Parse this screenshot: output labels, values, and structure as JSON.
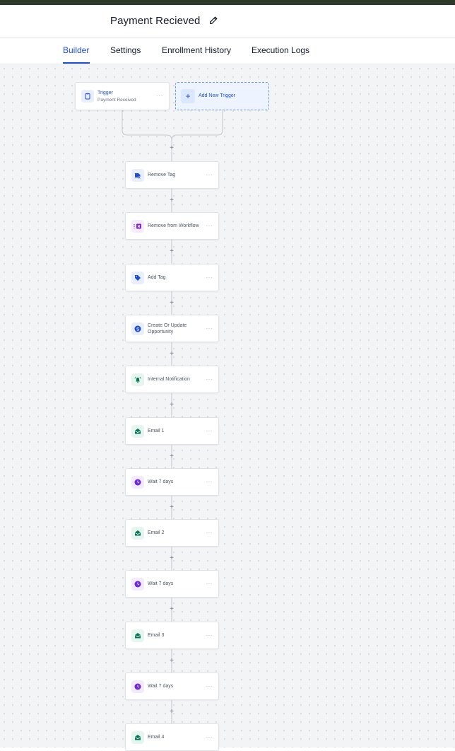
{
  "header": {
    "title": "Payment Recieved"
  },
  "tabs": [
    {
      "label": "Builder",
      "active": true
    },
    {
      "label": "Settings",
      "active": false
    },
    {
      "label": "Enrollment History",
      "active": false
    },
    {
      "label": "Execution Logs",
      "active": false
    }
  ],
  "trigger": {
    "title": "Trigger",
    "subtitle": "Payment Received",
    "menu": "···"
  },
  "add_trigger": {
    "label": "Add New Trigger",
    "plus": "+"
  },
  "plus_symbol": "+",
  "steps": [
    {
      "label": "Remove Tag",
      "icon": "remove-tag-icon",
      "menu": "···"
    },
    {
      "label": "Remove from Workflow",
      "icon": "remove-workflow-icon",
      "menu": "···"
    },
    {
      "label": "Add Tag",
      "icon": "tag-icon",
      "menu": "···"
    },
    {
      "label": "Create Or Update Opportunity",
      "icon": "dollar-icon",
      "menu": "···"
    },
    {
      "label": "Internal Notification",
      "icon": "bell-icon",
      "menu": "···"
    },
    {
      "label": "Email 1",
      "icon": "email-icon",
      "menu": "···"
    },
    {
      "label": "Wait 7 days",
      "icon": "clock-icon",
      "menu": "···"
    },
    {
      "label": "Email 2",
      "icon": "email-icon",
      "menu": "···"
    },
    {
      "label": "Wait 7 days",
      "icon": "clock-icon",
      "menu": "···"
    },
    {
      "label": "Email 3",
      "icon": "email-icon",
      "menu": "···"
    },
    {
      "label": "Wait 7 days",
      "icon": "clock-icon",
      "menu": "···"
    },
    {
      "label": "Email 4",
      "icon": "email-icon",
      "menu": "···"
    }
  ],
  "colors": {
    "accent": "#1d4ed8",
    "email": "#047857",
    "wait": "#6d28d9",
    "remove_workflow": "#7e22ce",
    "dollar": "#1d4ed8",
    "bell": "#047857"
  }
}
